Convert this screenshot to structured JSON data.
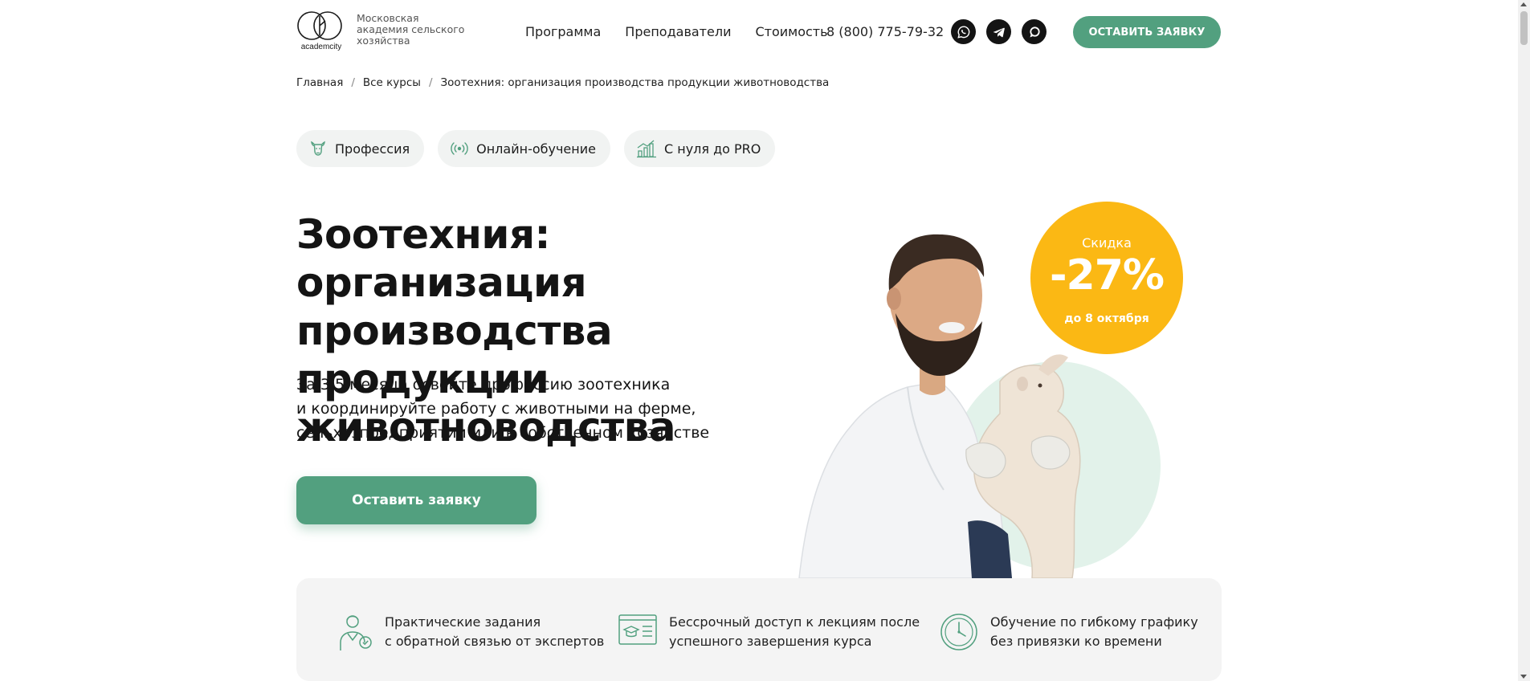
{
  "header": {
    "logo_caption": "academcity",
    "logo_lines": [
      "Московская",
      "академия сельского",
      "хозяйства"
    ],
    "nav": [
      "Программа",
      "Преподаватели",
      "Стоимость"
    ],
    "phone": "8 (800) 775-79-32",
    "socials": [
      "whatsapp-icon",
      "telegram-icon",
      "chat-icon"
    ],
    "cta": "Оставить заявку"
  },
  "breadcrumb": {
    "items": [
      "Главная",
      "Все курсы",
      "Зоотехния: организация производства продукции животноводства"
    ],
    "separator": "/"
  },
  "tags": [
    {
      "label": "Профессия",
      "icon": "cow-icon"
    },
    {
      "label": "Онлайн-обучение",
      "icon": "broadcast-icon"
    },
    {
      "label": "С нуля до PRO",
      "icon": "growth-chart-icon"
    }
  ],
  "hero": {
    "title_lines": [
      "Зоотехния: организация",
      "производства продукции",
      "животноводства"
    ],
    "subtitle_lines": [
      "За 3,5 месяца освойте профессию зоотехника",
      "и координируйте работу с животными на ферме,",
      "сельхозпредприятии или в собственном хозяйстве"
    ],
    "cta": "Оставить заявку",
    "discount": {
      "label": "Скидка",
      "value": "-27%",
      "until": "до 8 октября"
    }
  },
  "features": [
    {
      "icon": "expert-icon",
      "lines": [
        "Практические задания",
        "с обратной связью от экспертов"
      ]
    },
    {
      "icon": "lecture-icon",
      "lines": [
        "Бессрочный доступ к лекциям после",
        "успешного завершения курса"
      ]
    },
    {
      "icon": "clock-icon",
      "lines": [
        "Обучение по гибкому графику",
        "без привязки ко времени"
      ]
    }
  ],
  "colors": {
    "accent": "#52a07f",
    "discount": "#fbb814",
    "text": "#141414",
    "panel": "#f4f4f4"
  }
}
